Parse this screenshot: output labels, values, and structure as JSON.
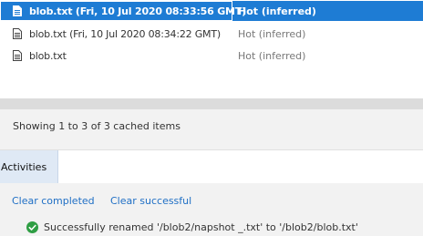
{
  "files": [
    {
      "name": "blob.txt (Fri, 10 Jul 2020 08:33:56 GMT)",
      "tier": "Hot (inferred)",
      "selected": true,
      "icon": "document-icon"
    },
    {
      "name": "blob.txt (Fri, 10 Jul 2020 08:34:22 GMT)",
      "tier": "Hot (inferred)",
      "selected": false,
      "icon": "document-icon"
    },
    {
      "name": "blob.txt",
      "tier": "Hot (inferred)",
      "selected": false,
      "icon": "document-icon"
    }
  ],
  "status": {
    "text": "Showing 1 to 3 of 3 cached items"
  },
  "activities_panel": {
    "tab_label": "Activities",
    "clear_completed": "Clear completed",
    "clear_successful": "Clear successful",
    "items": [
      {
        "icon": "success-check-icon",
        "message": "Successfully renamed '/blob2/napshot _.txt' to '/blob2/blob.txt'"
      }
    ]
  },
  "colors": {
    "selection": "#1e7cd4",
    "link": "#1f6fc5",
    "success": "#2f9e44",
    "tab_active": "#dfe9f5"
  }
}
